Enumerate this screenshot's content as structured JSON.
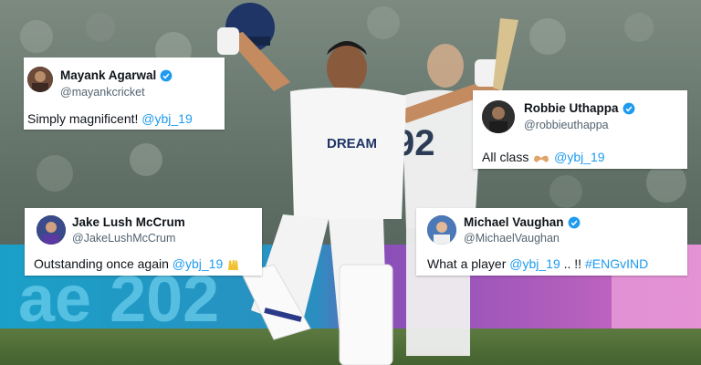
{
  "background": {
    "banner_text": "ae 202",
    "jersey_sponsor": "DREAM",
    "opponent_number": "92"
  },
  "tweets": [
    {
      "name": "Mayank Agarwal",
      "handle": "@mayankcricket",
      "verified": true,
      "text": "Simply magnificent! ",
      "mention": "@ybj_19",
      "suffix": ""
    },
    {
      "name": "Robbie Uthappa",
      "handle": "@robbieuthappa",
      "verified": true,
      "text": "All class ",
      "emoji": "heart-hands",
      "mention": "@ybj_19",
      "suffix": ""
    },
    {
      "name": "Jake Lush McCrum",
      "handle": "@JakeLushMcCrum",
      "verified": false,
      "text": "Outstanding once again ",
      "mention": "@ybj_19",
      "emoji": "raised-hands",
      "suffix": ""
    },
    {
      "name": "Michael Vaughan",
      "handle": "@MichaelVaughan",
      "verified": true,
      "text": "What a player ",
      "mention": "@ybj_19",
      "suffix": " .. !! ",
      "hashtag": "#ENGvIND"
    }
  ],
  "colors": {
    "verified": "#1d9bf0",
    "mention": "#1d9bf0",
    "text": "#0f1419",
    "handle": "#536471"
  }
}
